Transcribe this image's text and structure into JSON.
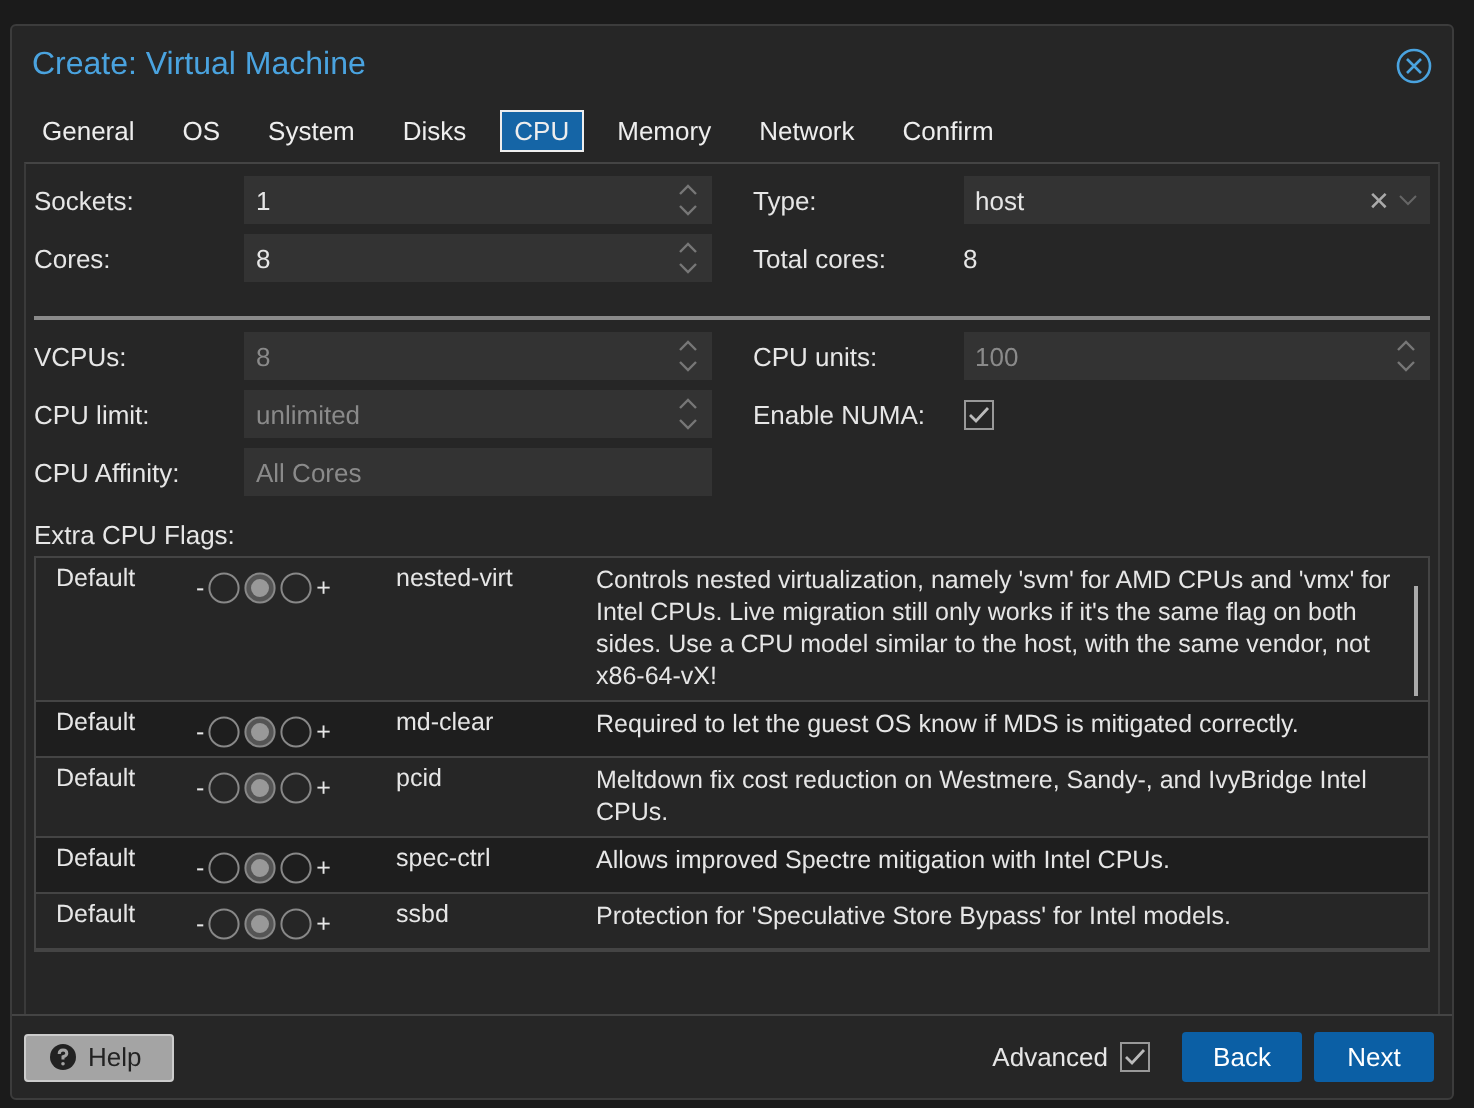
{
  "window": {
    "title": "Create: Virtual Machine"
  },
  "tabs": [
    {
      "label": "General",
      "selected": false
    },
    {
      "label": "OS",
      "selected": false
    },
    {
      "label": "System",
      "selected": false
    },
    {
      "label": "Disks",
      "selected": false
    },
    {
      "label": "CPU",
      "selected": true
    },
    {
      "label": "Memory",
      "selected": false
    },
    {
      "label": "Network",
      "selected": false
    },
    {
      "label": "Confirm",
      "selected": false
    }
  ],
  "basic": {
    "left": [
      {
        "label": "Sockets:",
        "kind": "spinner",
        "value": "1",
        "disabled": false
      },
      {
        "label": "Cores:",
        "kind": "spinner",
        "value": "8",
        "disabled": false
      }
    ],
    "right": [
      {
        "label": "Type:",
        "kind": "combo",
        "value": "host",
        "disabled": false,
        "clear": "✕"
      },
      {
        "label": "Total cores:",
        "kind": "display",
        "value": "8"
      }
    ]
  },
  "advanced": {
    "left": [
      {
        "label": "VCPUs:",
        "kind": "spinner",
        "value": "8",
        "disabled": true
      },
      {
        "label": "CPU limit:",
        "kind": "spinner",
        "value": "unlimited",
        "disabled": true
      },
      {
        "label": "CPU Affinity:",
        "kind": "text",
        "placeholder": "All Cores",
        "disabled": true
      }
    ],
    "right": [
      {
        "label": "CPU units:",
        "kind": "spinner",
        "value": "100",
        "disabled": true
      },
      {
        "label": "Enable NUMA:",
        "kind": "checkbox",
        "checked": true
      }
    ]
  },
  "flags": {
    "label": "Extra CPU Flags:",
    "rows": [
      {
        "state": "Default",
        "minus": "-",
        "plus": "+",
        "options": [
          {
            "selected": false
          },
          {
            "selected": true
          },
          {
            "selected": false
          }
        ],
        "flag": "nested-virt",
        "description": "Controls nested virtualization, namely 'svm' for AMD CPUs and 'vmx' for Intel CPUs. Live migration still only works if it's the same flag on both sides. Use a CPU model similar to the host, with the same vendor, not x86-64-vX!"
      },
      {
        "state": "Default",
        "minus": "-",
        "plus": "+",
        "options": [
          {
            "selected": false
          },
          {
            "selected": true
          },
          {
            "selected": false
          }
        ],
        "flag": "md-clear",
        "description": "Required to let the guest OS know if MDS is mitigated correctly."
      },
      {
        "state": "Default",
        "minus": "-",
        "plus": "+",
        "options": [
          {
            "selected": false
          },
          {
            "selected": true
          },
          {
            "selected": false
          }
        ],
        "flag": "pcid",
        "description": "Meltdown fix cost reduction on Westmere, Sandy-, and IvyBridge Intel CPUs."
      },
      {
        "state": "Default",
        "minus": "-",
        "plus": "+",
        "options": [
          {
            "selected": false
          },
          {
            "selected": true
          },
          {
            "selected": false
          }
        ],
        "flag": "spec-ctrl",
        "description": "Allows improved Spectre mitigation with Intel CPUs."
      },
      {
        "state": "Default",
        "minus": "-",
        "plus": "+",
        "options": [
          {
            "selected": false
          },
          {
            "selected": true
          },
          {
            "selected": false
          }
        ],
        "flag": "ssbd",
        "description": "Protection for 'Speculative Store Bypass' for Intel models."
      }
    ]
  },
  "footer": {
    "help": "Help",
    "advanced": {
      "label": "Advanced",
      "checked": true
    },
    "buttons": [
      "Back",
      "Next"
    ]
  }
}
